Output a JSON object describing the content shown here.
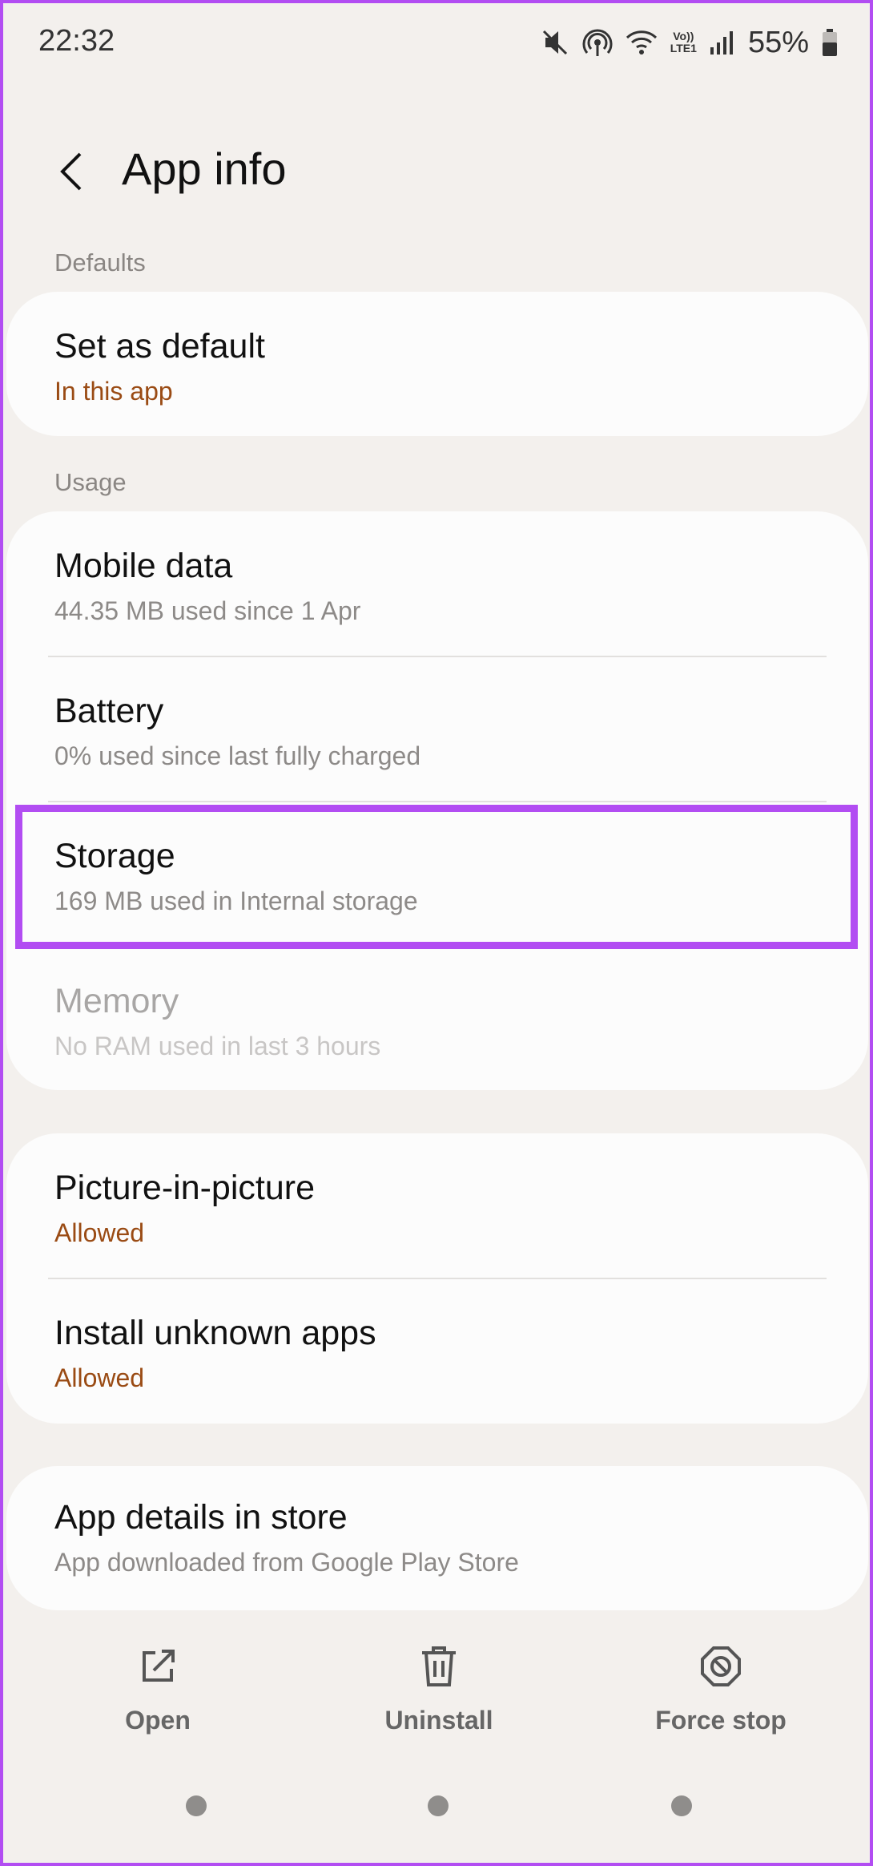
{
  "status_bar": {
    "time": "22:32",
    "icons": [
      "mute-icon",
      "hotspot-icon",
      "wifi-icon",
      "volte-icon",
      "signal-icon"
    ],
    "volte_top": "Vo))",
    "volte_bottom": "LTE1",
    "battery_percent": "55%",
    "battery_level": 0.55
  },
  "header": {
    "title": "App info"
  },
  "sections": {
    "defaults_label": "Defaults",
    "usage_label": "Usage"
  },
  "rows": {
    "set_default": {
      "title": "Set as default",
      "subtitle": "In this app"
    },
    "mobile_data": {
      "title": "Mobile data",
      "subtitle": "44.35 MB used since 1 Apr"
    },
    "battery": {
      "title": "Battery",
      "subtitle": "0% used since last fully charged"
    },
    "storage": {
      "title": "Storage",
      "subtitle": "169 MB used in Internal storage"
    },
    "memory": {
      "title": "Memory",
      "subtitle": "No RAM used in last 3 hours"
    },
    "pip": {
      "title": "Picture-in-picture",
      "subtitle": "Allowed"
    },
    "install_unknown": {
      "title": "Install unknown apps",
      "subtitle": "Allowed"
    },
    "app_details": {
      "title": "App details in store",
      "subtitle": "App downloaded from Google Play Store"
    }
  },
  "actions": {
    "open": "Open",
    "uninstall": "Uninstall",
    "force_stop": "Force stop"
  },
  "colors": {
    "accent_subtitle": "#9a4b14",
    "highlight": "#b24df2",
    "background": "#f3f0ed",
    "card": "#fcfcfc"
  }
}
